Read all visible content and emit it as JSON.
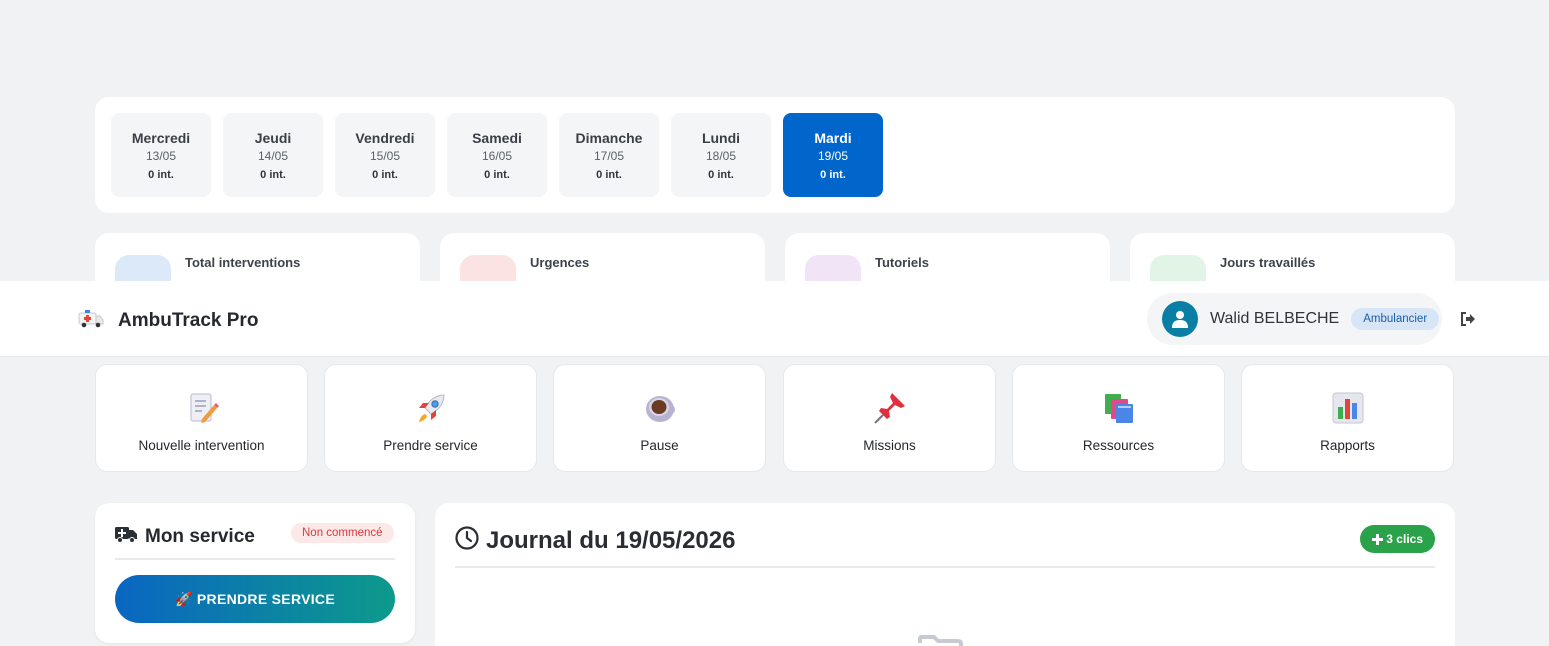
{
  "days": [
    {
      "name": "Mercredi",
      "date": "13/05",
      "count": "0 int.",
      "active": false
    },
    {
      "name": "Jeudi",
      "date": "14/05",
      "count": "0 int.",
      "active": false
    },
    {
      "name": "Vendredi",
      "date": "15/05",
      "count": "0 int.",
      "active": false
    },
    {
      "name": "Samedi",
      "date": "16/05",
      "count": "0 int.",
      "active": false
    },
    {
      "name": "Dimanche",
      "date": "17/05",
      "count": "0 int.",
      "active": false
    },
    {
      "name": "Lundi",
      "date": "18/05",
      "count": "0 int.",
      "active": false
    },
    {
      "name": "Mardi",
      "date": "19/05",
      "count": "0 int.",
      "active": true
    }
  ],
  "stats": [
    {
      "label": "Total interventions",
      "icon": "ambulance-icon",
      "color": "#0066cc"
    },
    {
      "label": "Urgences",
      "icon": "warning-icon",
      "color": "#e0453a"
    },
    {
      "label": "Tutoriels",
      "icon": "video-icon",
      "color": "#8e44ad"
    },
    {
      "label": "Jours travaillés",
      "icon": "calendar-icon",
      "color": "#27a24a"
    }
  ],
  "header": {
    "app_name": "AmbuTrack Pro",
    "user_name": "Walid BELBECHE",
    "role": "Ambulancier"
  },
  "actions": [
    {
      "label": "Nouvelle intervention",
      "icon": "memo-icon"
    },
    {
      "label": "Prendre service",
      "icon": "rocket-icon"
    },
    {
      "label": "Pause",
      "icon": "coffee-icon"
    },
    {
      "label": "Missions",
      "icon": "pushpin-icon"
    },
    {
      "label": "Ressources",
      "icon": "books-icon"
    },
    {
      "label": "Rapports",
      "icon": "bar-chart-icon"
    }
  ],
  "service": {
    "title": "Mon service",
    "status": "Non commencé",
    "button_label": "🚀 PRENDRE SERVICE"
  },
  "journal": {
    "title": "Journal du 19/05/2026",
    "badge": "3 clics"
  },
  "colors": {
    "primary": "#0066cc",
    "success": "#2aa24a",
    "danger": "#d63b3b",
    "teal": "#0d9a8c"
  }
}
